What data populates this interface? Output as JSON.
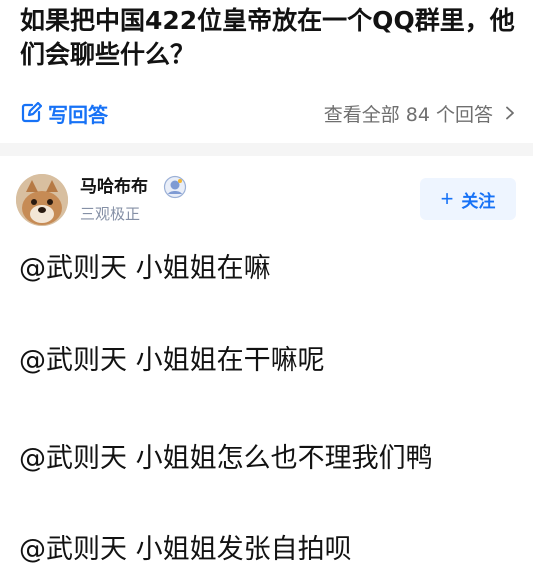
{
  "question": {
    "title": "如果把中国422位皇帝放在一个QQ群里，他们会聊些什么？"
  },
  "actions": {
    "write_answer": "写回答",
    "view_all": "查看全部 84 个回答"
  },
  "author": {
    "name": "马哈布布",
    "bio": "三观极正",
    "follow_label": "关注"
  },
  "answer": {
    "lines": [
      "@武则天 小姐姐在嘛",
      "@武则天 小姐姐在干嘛呢",
      "@武则天 小姐姐怎么也不理我们鸭",
      "@武则天 小姐姐发张自拍呗"
    ]
  },
  "colors": {
    "accent": "#1772f6",
    "follow_bg": "#eef5ff",
    "muted": "#8590a6",
    "divider": "#f5f5f5"
  },
  "icons": {
    "write": "edit-square-icon",
    "chevron": "chevron-right-icon",
    "badge": "avatar-badge-icon"
  }
}
